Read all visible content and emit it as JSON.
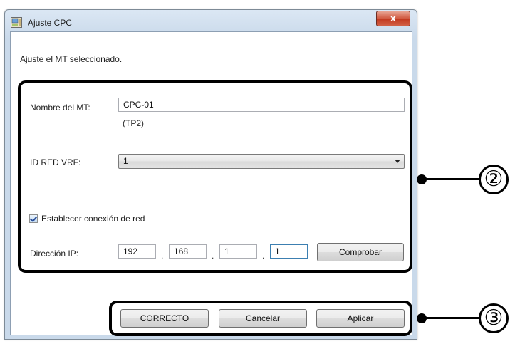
{
  "window": {
    "title": "Ajuste CPC",
    "close_glyph": "x"
  },
  "instruction": "Ajuste el MT seleccionado.",
  "form": {
    "mt_name_label": "Nombre del MT:",
    "mt_name_value": "CPC-01",
    "mt_code": "(TP2)",
    "vrf_label": "ID RED VRF:",
    "vrf_value": "1",
    "network_checkbox_label": "Establecer conexión de red",
    "network_checkbox_checked": true,
    "ip_label": "Dirección IP:",
    "ip_octets": [
      "192",
      "168",
      "1",
      "1"
    ],
    "ip_separator": ".",
    "check_button": "Comprobar"
  },
  "buttons": {
    "ok": "CORRECTO",
    "cancel": "Cancelar",
    "apply": "Aplicar"
  },
  "callouts": {
    "settings_group": "②",
    "buttons_group": "③"
  }
}
